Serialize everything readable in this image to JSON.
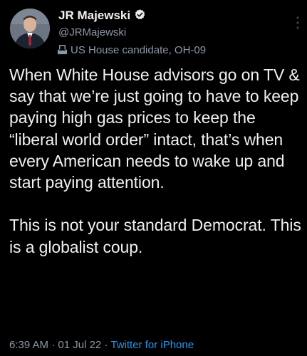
{
  "author": {
    "display_name": "JR Majewski",
    "handle": "@JRMajewski",
    "label": "US House candidate, OH-09",
    "avatar_icon": "profile-photo",
    "verified_icon": "verified-badge-icon",
    "label_icon": "ballot-box-icon"
  },
  "tweet": {
    "text": "When White House advisors go on TV & say that we’re just going to have to keep paying high gas prices to keep the “liberal world order” intact, that’s when every American needs to wake up and start paying attention.\n\nThis is not your standard Democrat. This is a globalist coup.",
    "time": "6:39 AM",
    "separator": "·",
    "date": "01 Jul 22",
    "source": "Twitter for iPhone"
  },
  "colors": {
    "background": "#000000",
    "text": "#e7e9ea",
    "secondary": "#8b98a5",
    "link": "#1d9bf0"
  }
}
